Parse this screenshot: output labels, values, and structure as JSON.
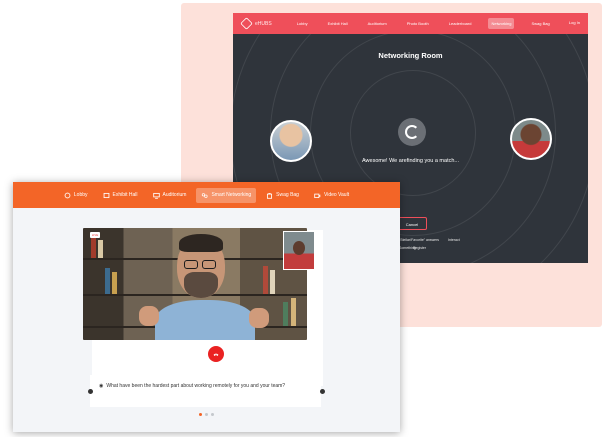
{
  "back_window": {
    "logo_text": "eHUBS",
    "nav_items": [
      "Lobby",
      "Exhibit Hall",
      "Auditorium",
      "Photo Booth",
      "Leaderboard",
      "Networking",
      "Swag Bag"
    ],
    "active_nav": "Networking",
    "logout_label": "Log In",
    "room_title": "Networking Room",
    "status_text": "Awesome! We arefinding you a match...",
    "button_label": "Cancel",
    "small_text_1": "\"Stellar/Favorite\" answers",
    "small_text_2": "Interact",
    "small_text_3": "Something",
    "small_text_4": "Register"
  },
  "front_window": {
    "nav_tabs": [
      {
        "label": "Lobby",
        "icon": "lobby-icon"
      },
      {
        "label": "Exhibit Hall",
        "icon": "exhibit-icon"
      },
      {
        "label": "Auditorium",
        "icon": "auditorium-icon"
      },
      {
        "label": "Smart Networking",
        "icon": "networking-icon"
      },
      {
        "label": "Swag Bag",
        "icon": "bag-icon"
      },
      {
        "label": "Video Vault",
        "icon": "video-icon"
      }
    ],
    "active_tab": "Smart Networking",
    "live_badge": "LIVE",
    "question_text": "What have been the hardest part about working remotely for you and your team?",
    "pager_total": 3,
    "pager_active": 1
  },
  "colors": {
    "back_accent": "#ef4f5a",
    "front_accent": "#f36527",
    "dark_screen": "#2f343b",
    "call_red": "#ea2222"
  }
}
